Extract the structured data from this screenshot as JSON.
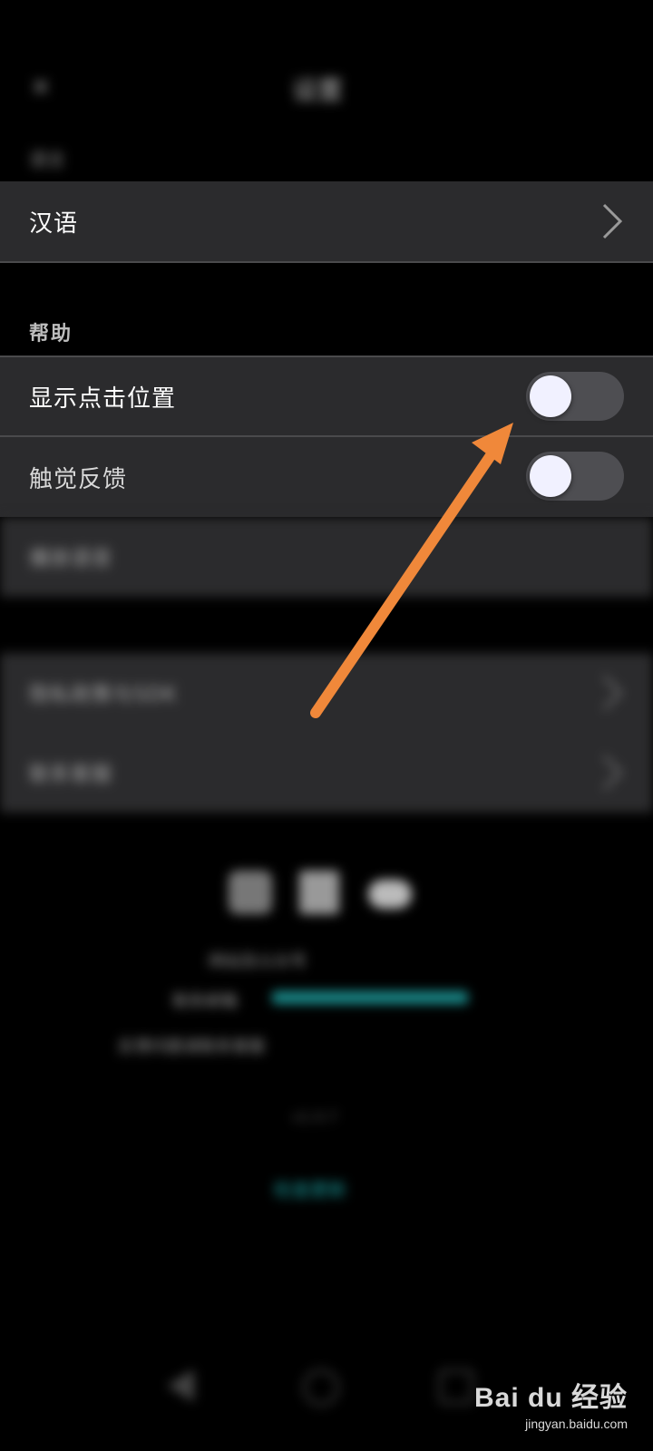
{
  "header": {
    "title": "设置",
    "close_icon": "close-icon",
    "section_language": "语言"
  },
  "language": {
    "value": "汉语"
  },
  "help": {
    "section_label": "帮助",
    "show_touch_label": "显示点击位置",
    "show_touch_on": false,
    "haptic_label": "触觉反馈",
    "haptic_on": false,
    "third_label": "播放语音"
  },
  "more": {
    "item1_label": "隐私政策与SDK",
    "item2_label": "联系客服"
  },
  "footer": {
    "company_line": "网站及公众号",
    "email_line": "联系邮箱",
    "notice_line": "反馈问题请联系客服",
    "version": "v1.0.7",
    "link": "检查更新"
  },
  "watermark": {
    "logo": "Bai du 经验",
    "url": "jingyan.baidu.com"
  },
  "annotation": {
    "arrow_color": "#f0883a"
  }
}
